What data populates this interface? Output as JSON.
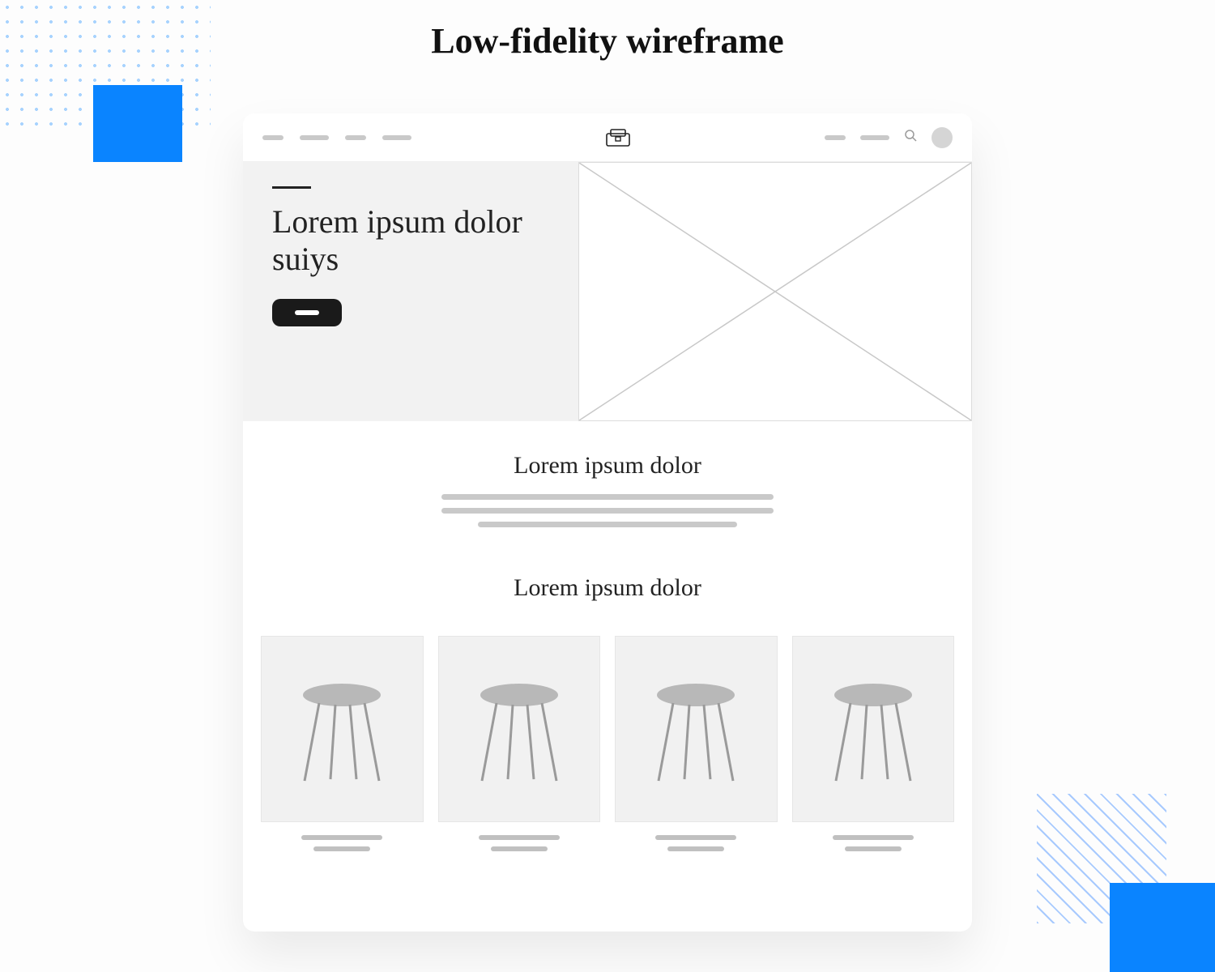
{
  "page": {
    "title": "Low-fidelity wireframe"
  },
  "hero": {
    "title": "Lorem ipsum dolor suiys"
  },
  "section1": {
    "title": "Lorem ipsum dolor"
  },
  "section2": {
    "title": "Lorem ipsum dolor"
  },
  "colors": {
    "accent": "#0a84ff"
  }
}
